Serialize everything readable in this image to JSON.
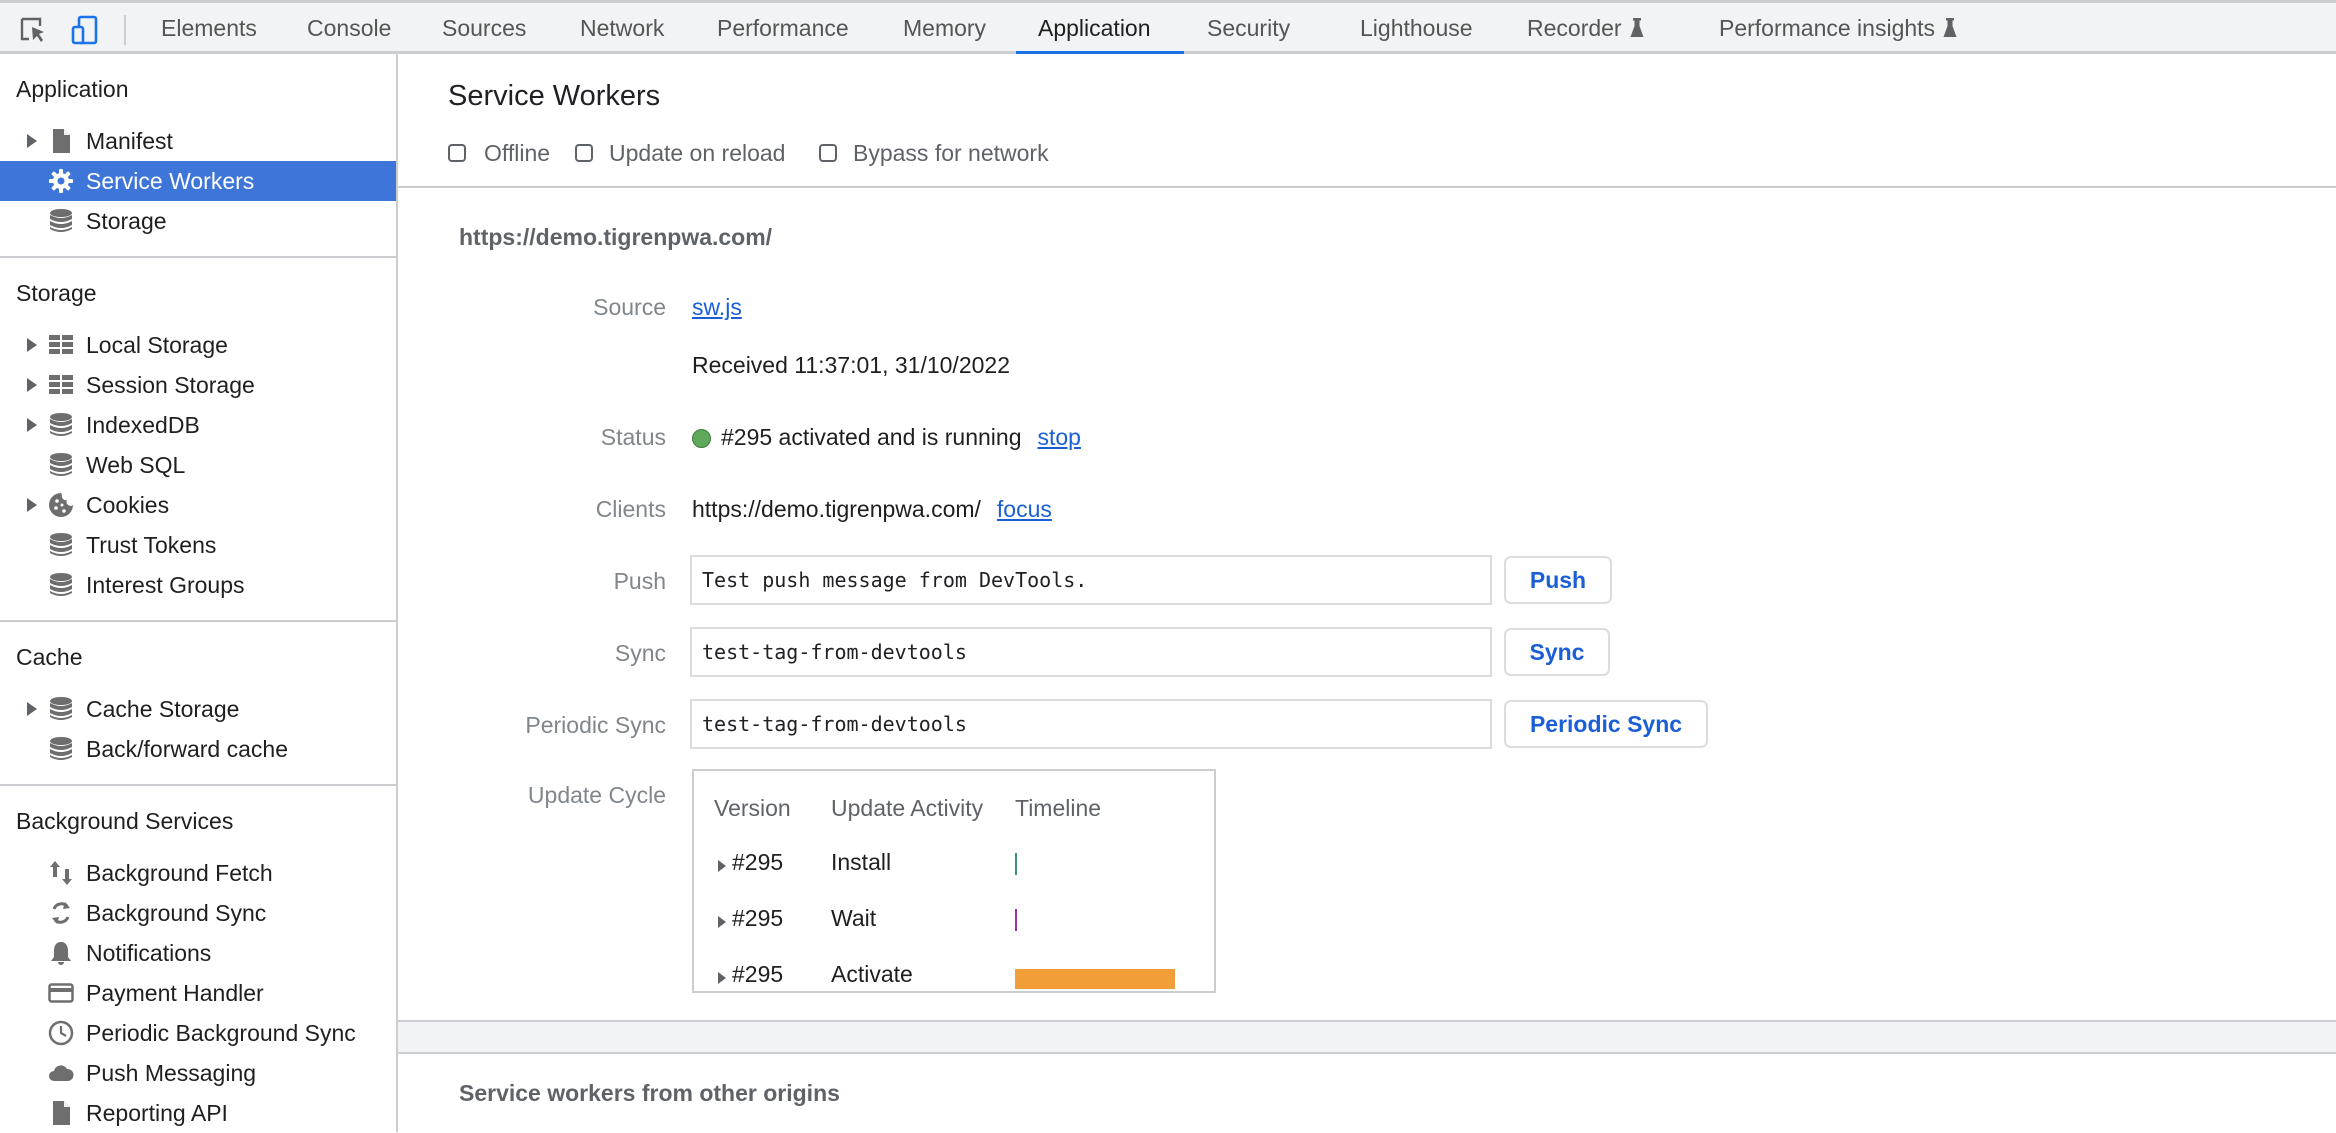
{
  "toolbar": {
    "inspect_icon": "inspect-element-icon",
    "device_icon": "device-toolbar-icon",
    "tabs": [
      {
        "label": "Elements"
      },
      {
        "label": "Console"
      },
      {
        "label": "Sources"
      },
      {
        "label": "Network"
      },
      {
        "label": "Performance"
      },
      {
        "label": "Memory"
      },
      {
        "label": "Application",
        "active": true
      },
      {
        "label": "Security"
      },
      {
        "label": "Lighthouse"
      },
      {
        "label": "Recorder",
        "icon": "flask-icon"
      },
      {
        "label": "Performance insights",
        "icon": "flask-icon"
      }
    ]
  },
  "sidebar": {
    "sections": [
      {
        "header": "Application",
        "items": [
          {
            "label": "Manifest",
            "icon": "file-icon",
            "expandable": true
          },
          {
            "label": "Service Workers",
            "icon": "gear-icon",
            "selected": true
          },
          {
            "label": "Storage",
            "icon": "database-icon"
          }
        ]
      },
      {
        "header": "Storage",
        "items": [
          {
            "label": "Local Storage",
            "icon": "table-icon",
            "expandable": true
          },
          {
            "label": "Session Storage",
            "icon": "table-icon",
            "expandable": true
          },
          {
            "label": "IndexedDB",
            "icon": "database-icon",
            "expandable": true
          },
          {
            "label": "Web SQL",
            "icon": "database-icon"
          },
          {
            "label": "Cookies",
            "icon": "cookie-icon",
            "expandable": true
          },
          {
            "label": "Trust Tokens",
            "icon": "database-icon"
          },
          {
            "label": "Interest Groups",
            "icon": "database-icon"
          }
        ]
      },
      {
        "header": "Cache",
        "items": [
          {
            "label": "Cache Storage",
            "icon": "database-icon",
            "expandable": true
          },
          {
            "label": "Back/forward cache",
            "icon": "database-icon"
          }
        ]
      },
      {
        "header": "Background Services",
        "items": [
          {
            "label": "Background Fetch",
            "icon": "up-down-arrows-icon"
          },
          {
            "label": "Background Sync",
            "icon": "sync-icon"
          },
          {
            "label": "Notifications",
            "icon": "bell-icon"
          },
          {
            "label": "Payment Handler",
            "icon": "credit-card-icon"
          },
          {
            "label": "Periodic Background Sync",
            "icon": "clock-icon"
          },
          {
            "label": "Push Messaging",
            "icon": "cloud-icon"
          },
          {
            "label": "Reporting API",
            "icon": "file-icon"
          }
        ]
      }
    ]
  },
  "main": {
    "title": "Service Workers",
    "checkboxes": [
      {
        "label": "Offline",
        "checked": false
      },
      {
        "label": "Update on reload",
        "checked": false
      },
      {
        "label": "Bypass for network",
        "checked": false
      }
    ],
    "origin": "https://demo.tigrenpwa.com/",
    "source_label": "Source",
    "source_link": "sw.js",
    "received": "Received 11:37:01, 31/10/2022",
    "status_label": "Status",
    "status_color": "#5ea95b",
    "status_text": "#295 activated and is running",
    "status_action": "stop",
    "clients_label": "Clients",
    "clients_url": "https://demo.tigrenpwa.com/",
    "clients_action": "focus",
    "push_label": "Push",
    "push_value": "Test push message from DevTools.",
    "push_button": "Push",
    "sync_label": "Sync",
    "sync_value": "test-tag-from-devtools",
    "sync_button": "Sync",
    "periodic_label": "Periodic Sync",
    "periodic_value": "test-tag-from-devtools",
    "periodic_button": "Periodic Sync",
    "update_cycle_label": "Update Cycle",
    "update_cycle": {
      "headers": [
        "Version",
        "Update Activity",
        "Timeline"
      ],
      "rows": [
        {
          "version": "#295",
          "activity": "Install",
          "color": "#3a8f80",
          "timeline_fraction": 0.0
        },
        {
          "version": "#295",
          "activity": "Wait",
          "color": "#9b2fae",
          "timeline_fraction": 0.0
        },
        {
          "version": "#295",
          "activity": "Activate",
          "color": "#f29e38",
          "timeline_fraction": 1.0
        }
      ]
    },
    "other_origins": "Service workers from other origins"
  }
}
